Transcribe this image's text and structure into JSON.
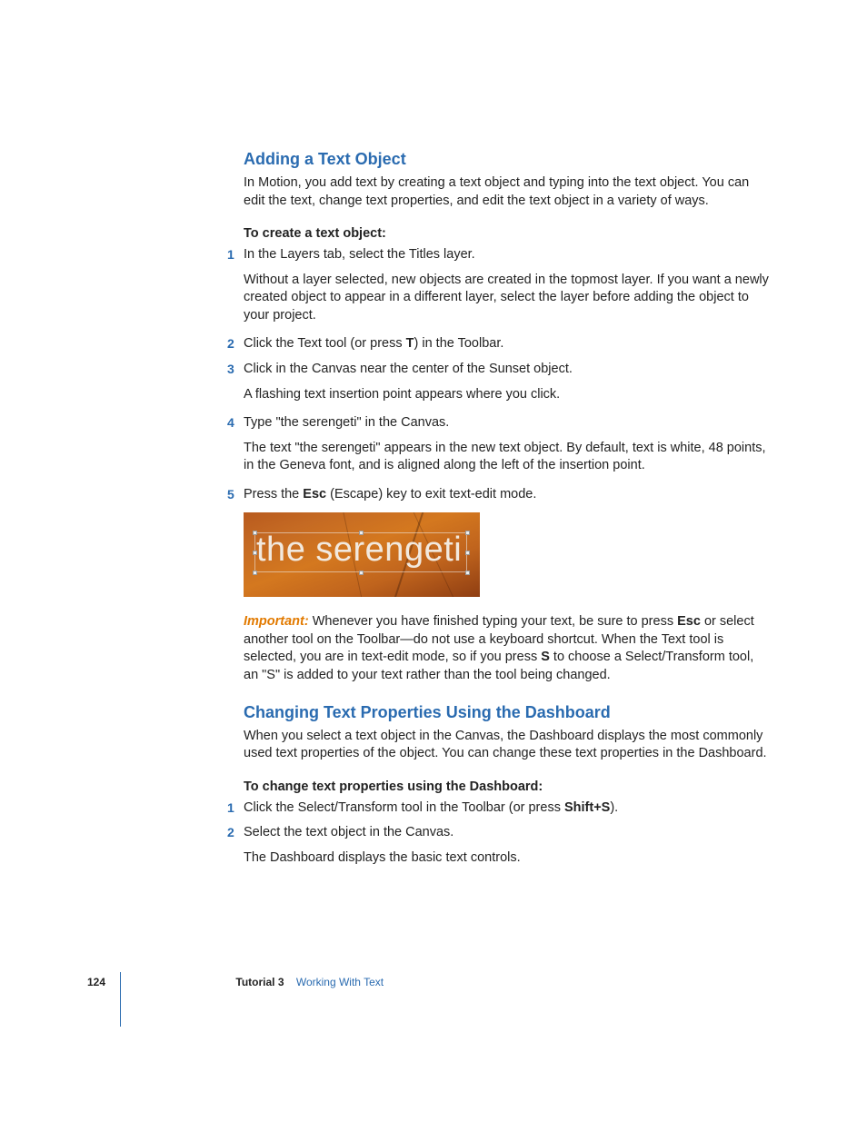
{
  "section1": {
    "heading": "Adding a Text Object",
    "intro": "In Motion, you add text by creating a text object and typing into the text object. You can edit the text, change text properties, and edit the text object in a variety of ways.",
    "leadIn": "To create a text object:",
    "steps": [
      {
        "main": "In the Layers tab, select the Titles layer.",
        "body": "Without a layer selected, new objects are created in the topmost layer. If you want a newly created object to appear in a different layer, select the layer before adding the object to your project."
      },
      {
        "pre": "Click the Text tool (or press ",
        "kbd": "T",
        "post": ") in the Toolbar."
      },
      {
        "main": "Click in the Canvas near the center of the Sunset object.",
        "body": "A flashing text insertion point appears where you click."
      },
      {
        "main": "Type \"the serengeti\" in the Canvas.",
        "body": "The text \"the serengeti\" appears in the new text object. By default, text is white, 48 points, in the Geneva font, and is aligned along the left of the insertion point."
      },
      {
        "pre": "Press the ",
        "kbd": "Esc",
        "post": " (Escape) key to exit text-edit mode."
      }
    ]
  },
  "figure": {
    "text": "the serengeti"
  },
  "important": {
    "label": "Important:",
    "pre": "  Whenever you have finished typing your text, be sure to press ",
    "kbd1": "Esc",
    "mid": " or select another tool on the Toolbar—do not use a keyboard shortcut. When the Text tool is selected, you are in text-edit mode, so if you press ",
    "kbd2": "S",
    "post": " to choose a Select/Transform tool, an \"S\" is added to your text rather than the tool being changed."
  },
  "section2": {
    "heading": "Changing Text Properties Using the Dashboard",
    "intro": "When you select a text object in the Canvas, the Dashboard displays the most commonly used text properties of the object. You can change these text properties in the Dashboard.",
    "leadIn": "To change text properties using the Dashboard:",
    "steps": [
      {
        "pre": "Click the Select/Transform tool in the Toolbar (or press ",
        "kbd": "Shift+S",
        "post": ")."
      },
      {
        "main": "Select the text object in the Canvas.",
        "body": "The Dashboard displays the basic text controls."
      }
    ]
  },
  "footer": {
    "page": "124",
    "tutorial": "Tutorial 3",
    "chapter": "Working With Text"
  }
}
